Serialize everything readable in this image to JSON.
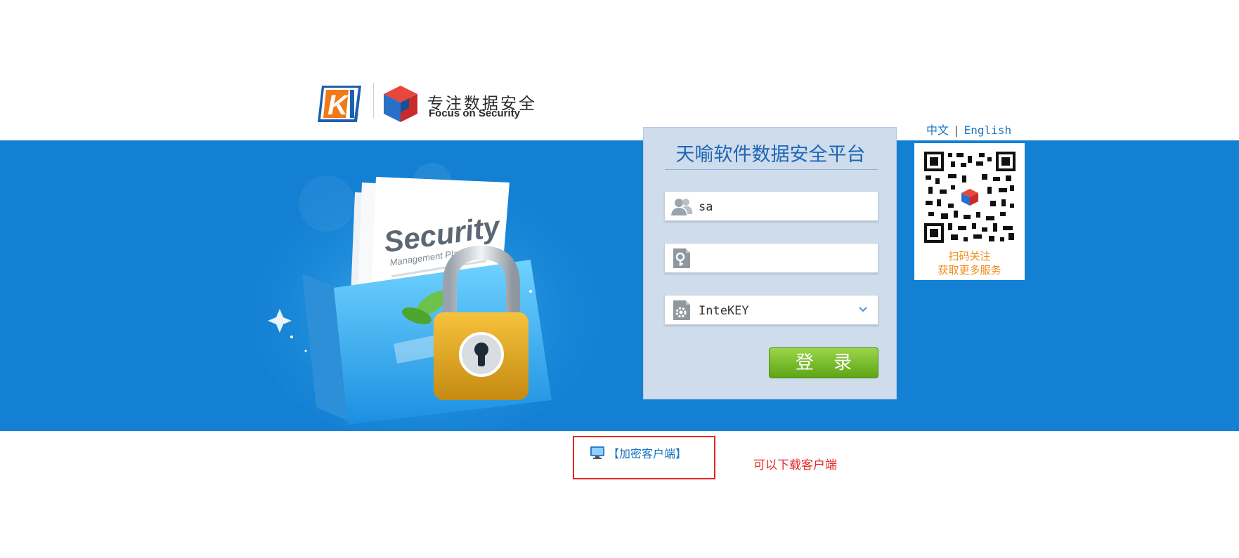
{
  "header": {
    "slogan_cn": "专注数据安全",
    "slogan_en": "Focus on Security"
  },
  "illustration": {
    "caption_main": "Security",
    "caption_sub": "Management Platform"
  },
  "login": {
    "title": "天喻软件数据安全平台",
    "username_value": "sa",
    "password_value": "",
    "auth_type_value": "InteKEY",
    "submit_label": "登 录"
  },
  "language": {
    "chinese": "中文",
    "separator": "|",
    "english": "English"
  },
  "qr": {
    "line1": "扫码关注",
    "line2": "获取更多服务"
  },
  "footer": {
    "client_link": "【加密客户端】",
    "note": "可以下载客户端"
  },
  "colors": {
    "band_blue": "#1380d4",
    "panel_bg": "#cfdcec",
    "title_blue": "#1d66b5",
    "button_green": "#6cb520",
    "qr_orange": "#f08c1a",
    "annotation_red": "#e52525"
  }
}
